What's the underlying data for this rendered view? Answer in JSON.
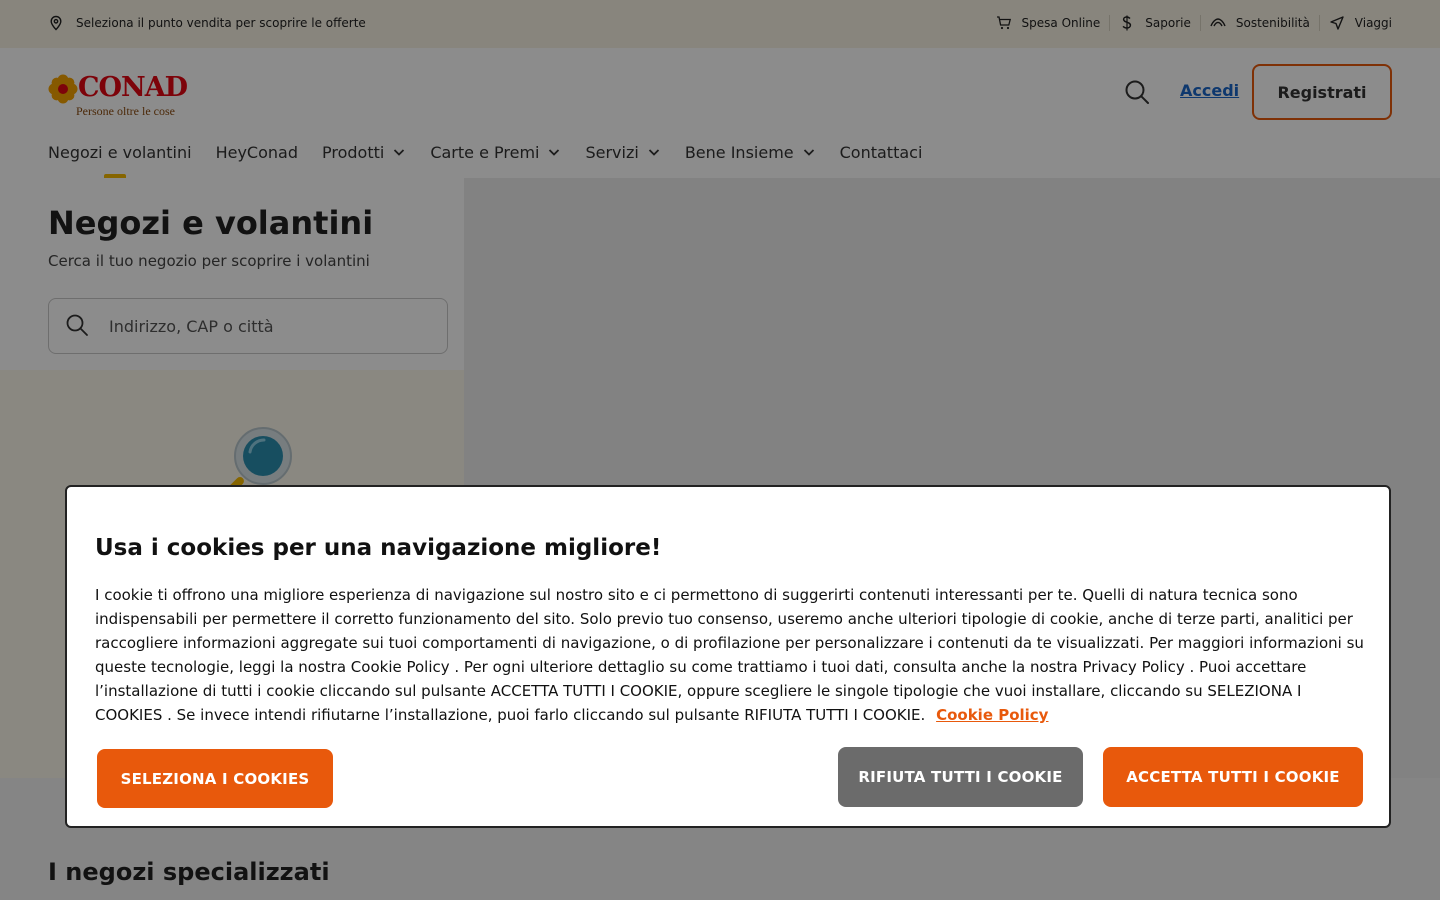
{
  "utility": {
    "store_prompt": "Seleziona il punto vendita per scoprire le offerte",
    "links": [
      {
        "label": "Spesa Online",
        "icon": "cart-icon"
      },
      {
        "label": "Saporie",
        "icon": "saporie-icon"
      },
      {
        "label": "Sostenibilità",
        "icon": "leaf-icon"
      },
      {
        "label": "Viaggi",
        "icon": "plane-icon"
      }
    ]
  },
  "header": {
    "logo_text": "CONAD",
    "logo_tagline": "Persone oltre le cose",
    "login_label": "Accedi",
    "register_label": "Registrati"
  },
  "nav": [
    {
      "label": "Negozi e volantini",
      "has_dropdown": false,
      "active": true
    },
    {
      "label": "HeyConad",
      "has_dropdown": false
    },
    {
      "label": "Prodotti",
      "has_dropdown": true
    },
    {
      "label": "Carte e Premi",
      "has_dropdown": true
    },
    {
      "label": "Servizi",
      "has_dropdown": true
    },
    {
      "label": "Bene Insieme",
      "has_dropdown": true
    },
    {
      "label": "Contattaci",
      "has_dropdown": false
    }
  ],
  "main": {
    "title": "Negozi e volantini",
    "subtitle": "Cerca il tuo negozio per scoprire i volantini",
    "search_placeholder": "Indirizzo, CAP o città",
    "specialized_title": "I negozi specializzati"
  },
  "cookie": {
    "title": "Usa i cookies per una navigazione migliore!",
    "body": "I cookie ti offrono una migliore esperienza di navigazione sul nostro sito e ci permettono di suggerirti contenuti interessanti per te. Quelli di natura tecnica sono indispensabili per permettere il corretto funzionamento del sito. Solo previo tuo consenso, useremo anche ulteriori tipologie di cookie, anche di terze parti, analitici per raccogliere informazioni aggregate sui tuoi comportamenti di navigazione, o di profilazione per personalizzare i contenuti da te visualizzati. Per maggiori informazioni su queste tecnologie, leggi la nostra Cookie Policy . Per ogni ulteriore dettaglio su come trattiamo i tuoi dati, consulta anche la nostra Privacy Policy . Puoi accettare l’installazione di tutti i cookie cliccando sul pulsante ACCETTA TUTTI I COOKIE, oppure scegliere le singole tipologie che vuoi installare, cliccando su SELEZIONA I COOKIES . Se invece intendi rifiutarne l’installazione, puoi farlo cliccando sul pulsante RIFIUTA TUTTI I COOKIE.",
    "policy_link": "Cookie Policy",
    "select_label": "SELEZIONA I COOKIES",
    "reject_label": "RIFIUTA TUTTI I COOKIE",
    "accept_label": "ACCETTA TUTTI I COOKIE"
  },
  "colors": {
    "brand_red": "#e30613",
    "accent_orange": "#e8590c",
    "link_blue": "#1a66c9",
    "nav_indicator": "#f5b800",
    "utility_bg": "#f7f2e4",
    "reject_gray": "#6b6b6b"
  }
}
